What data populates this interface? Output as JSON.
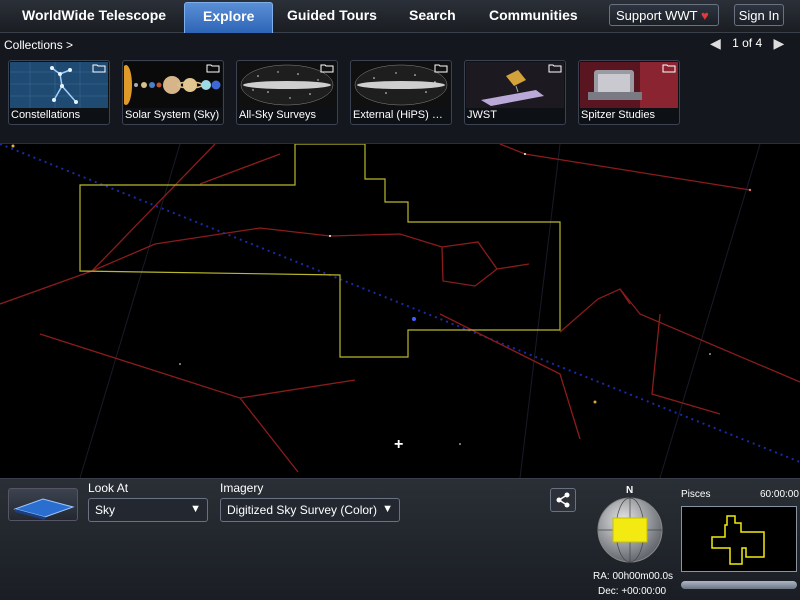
{
  "topbar": {
    "brand": "WorldWide Telescope",
    "tabs": [
      "Explore",
      "Guided Tours",
      "Search",
      "Communities"
    ],
    "support_label": "Support WWT",
    "support_icon": "heart-icon",
    "signin_label": "Sign In"
  },
  "ribbon": {
    "collections_label": "Collections >",
    "page_indicator": "1 of 4",
    "items": [
      {
        "label": "Constellations",
        "icon": "folder-icon"
      },
      {
        "label": "Solar System (Sky)",
        "icon": "folder-icon"
      },
      {
        "label": "All-Sky Surveys",
        "icon": "folder-icon"
      },
      {
        "label": "External (HiPS) Sur...",
        "icon": "folder-icon"
      },
      {
        "label": "JWST",
        "icon": "folder-icon"
      },
      {
        "label": "Spitzer Studies",
        "icon": "folder-icon"
      }
    ]
  },
  "bottom": {
    "look_at_label": "Look At",
    "look_at_value": "Sky",
    "imagery_label": "Imagery",
    "imagery_value": "Digitized Sky Survey (Color)",
    "compass_n": "N",
    "ra": "RA: 00h00m00.0s",
    "dec": "Dec: +00:00:00",
    "constellation": "Pisces",
    "fov": "60:00:00"
  },
  "colors": {
    "accent": "#2d64b6",
    "constellation_line": "#8a1c1c",
    "boundary": "#b9b82c",
    "view_box": "#f2ea10"
  }
}
